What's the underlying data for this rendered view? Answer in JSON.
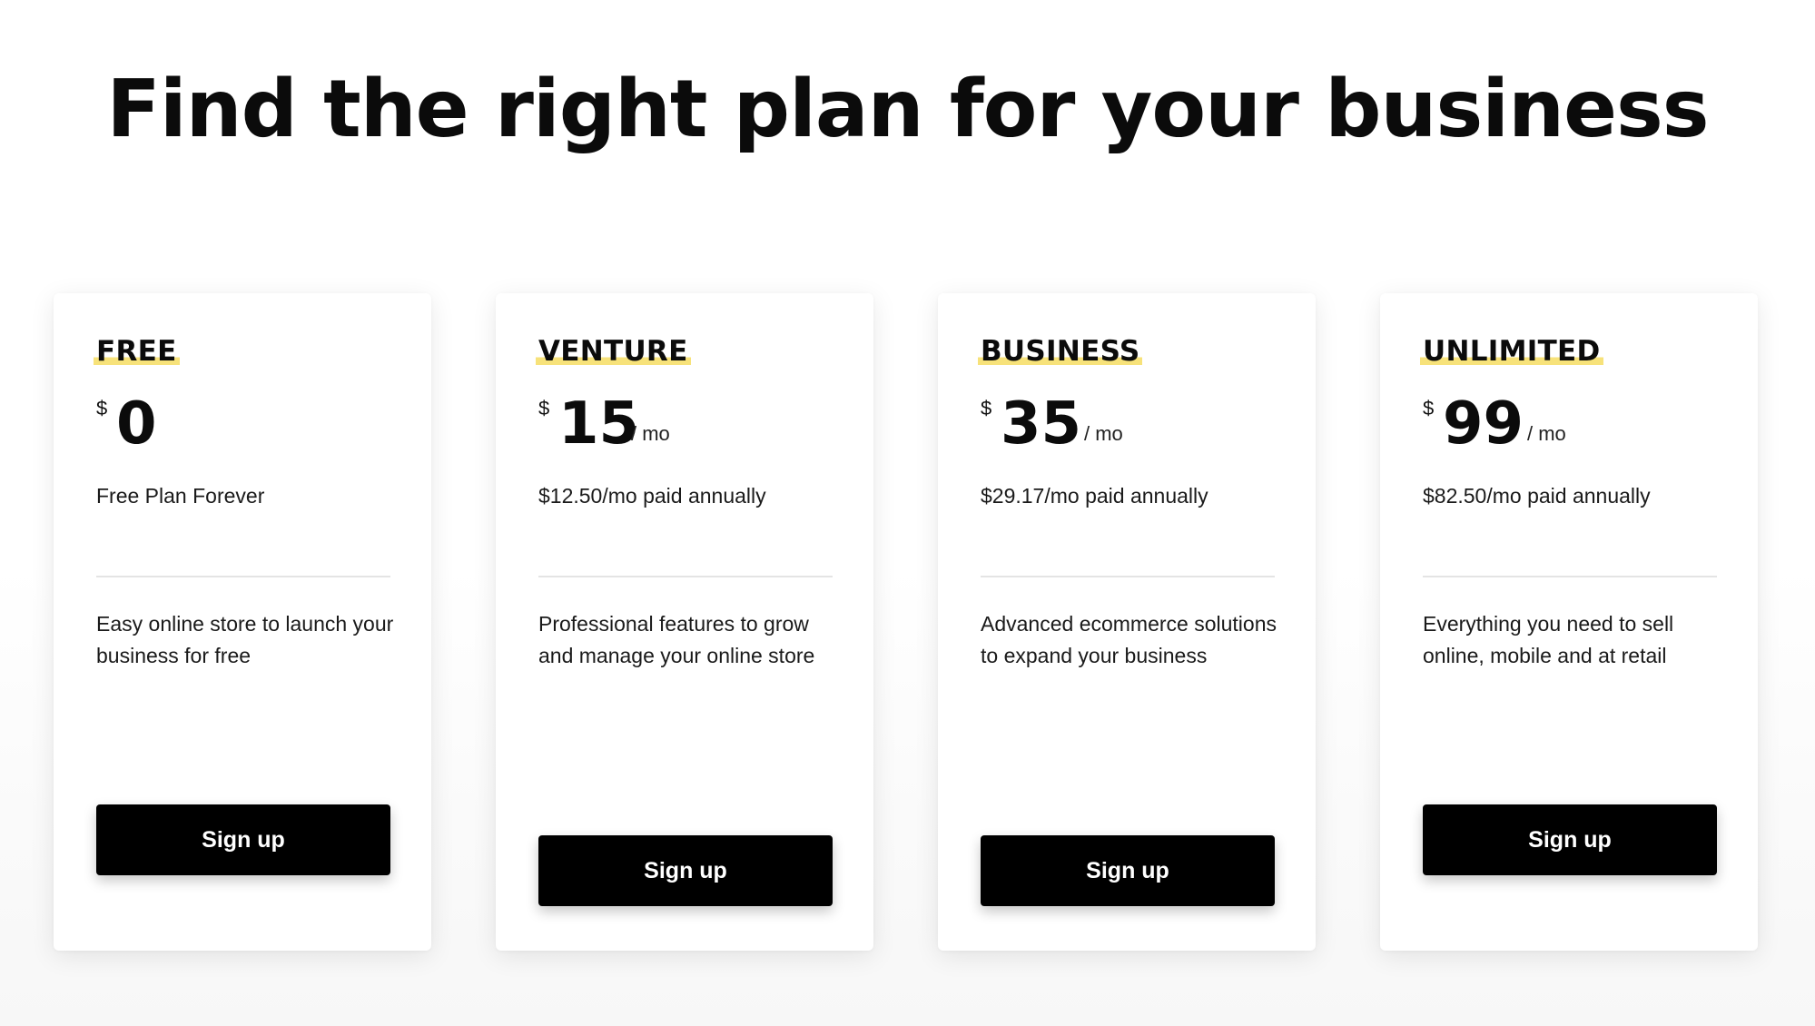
{
  "page": {
    "title": "Find the right plan for your business"
  },
  "plans": [
    {
      "name": "FREE",
      "currency": "$",
      "price": "0",
      "period": "",
      "price_note": "Free Plan Forever",
      "description": "Easy online store to launch your business for free",
      "cta_label": "Sign up"
    },
    {
      "name": "VENTURE",
      "currency": "$",
      "price": "15",
      "period": "/ mo",
      "price_note": "$12.50/mo paid annually",
      "description": "Professional features to grow and manage your online store",
      "cta_label": "Sign up"
    },
    {
      "name": "BUSINESS",
      "currency": "$",
      "price": "35",
      "period": "/ mo",
      "price_note": "$29.17/mo paid annually",
      "description": "Advanced ecommerce solutions to expand your business",
      "cta_label": "Sign up"
    },
    {
      "name": "UNLIMITED",
      "currency": "$",
      "price": "99",
      "period": "/ mo",
      "price_note": "$82.50/mo paid annually",
      "description": "Everything you need to sell online, mobile and at retail",
      "cta_label": "Sign up"
    }
  ],
  "colors": {
    "highlight": "#f7e27a",
    "button_background": "#000000",
    "button_text": "#ffffff"
  }
}
